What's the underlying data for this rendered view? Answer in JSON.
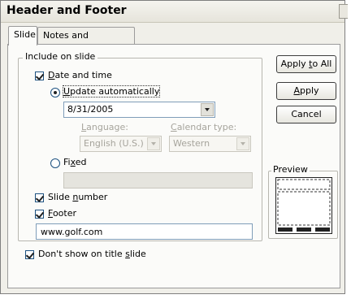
{
  "dialog": {
    "title": "Header and Footer",
    "tabs": [
      {
        "label": "Slide",
        "active": true
      },
      {
        "label": "Notes and Handouts",
        "active": false
      }
    ]
  },
  "include_group": {
    "legend": "Include on slide",
    "date_time": {
      "pre": "",
      "mn": "D",
      "post": "ate and time",
      "checked": true
    },
    "update_auto": {
      "pre": "",
      "mn": "U",
      "post": "pdate automatically",
      "selected": true
    },
    "date_value": "8/31/2005",
    "language": {
      "pre": "",
      "mn": "L",
      "post": "anguage:",
      "value": "English (U.S.)"
    },
    "calendar": {
      "pre": "",
      "mn": "C",
      "post": "alendar type:",
      "value": "Western"
    },
    "fixed": {
      "pre": "Fi",
      "mn": "x",
      "post": "ed",
      "selected": false,
      "value": ""
    },
    "slide_number": {
      "pre": "Slide ",
      "mn": "n",
      "post": "umber",
      "checked": true
    },
    "footer": {
      "pre": "",
      "mn": "F",
      "post": "ooter",
      "checked": true,
      "value": "www.golf.com"
    }
  },
  "dont_show": {
    "pre": "Don't show on title ",
    "mn": "s",
    "post": "lide",
    "checked": true
  },
  "buttons": {
    "apply_all": {
      "pre": "Apply ",
      "mn": "t",
      "post": "o All"
    },
    "apply": {
      "pre": "",
      "mn": "A",
      "post": "pply"
    },
    "cancel": {
      "label": "Cancel"
    }
  },
  "preview": {
    "legend": "Preview"
  }
}
